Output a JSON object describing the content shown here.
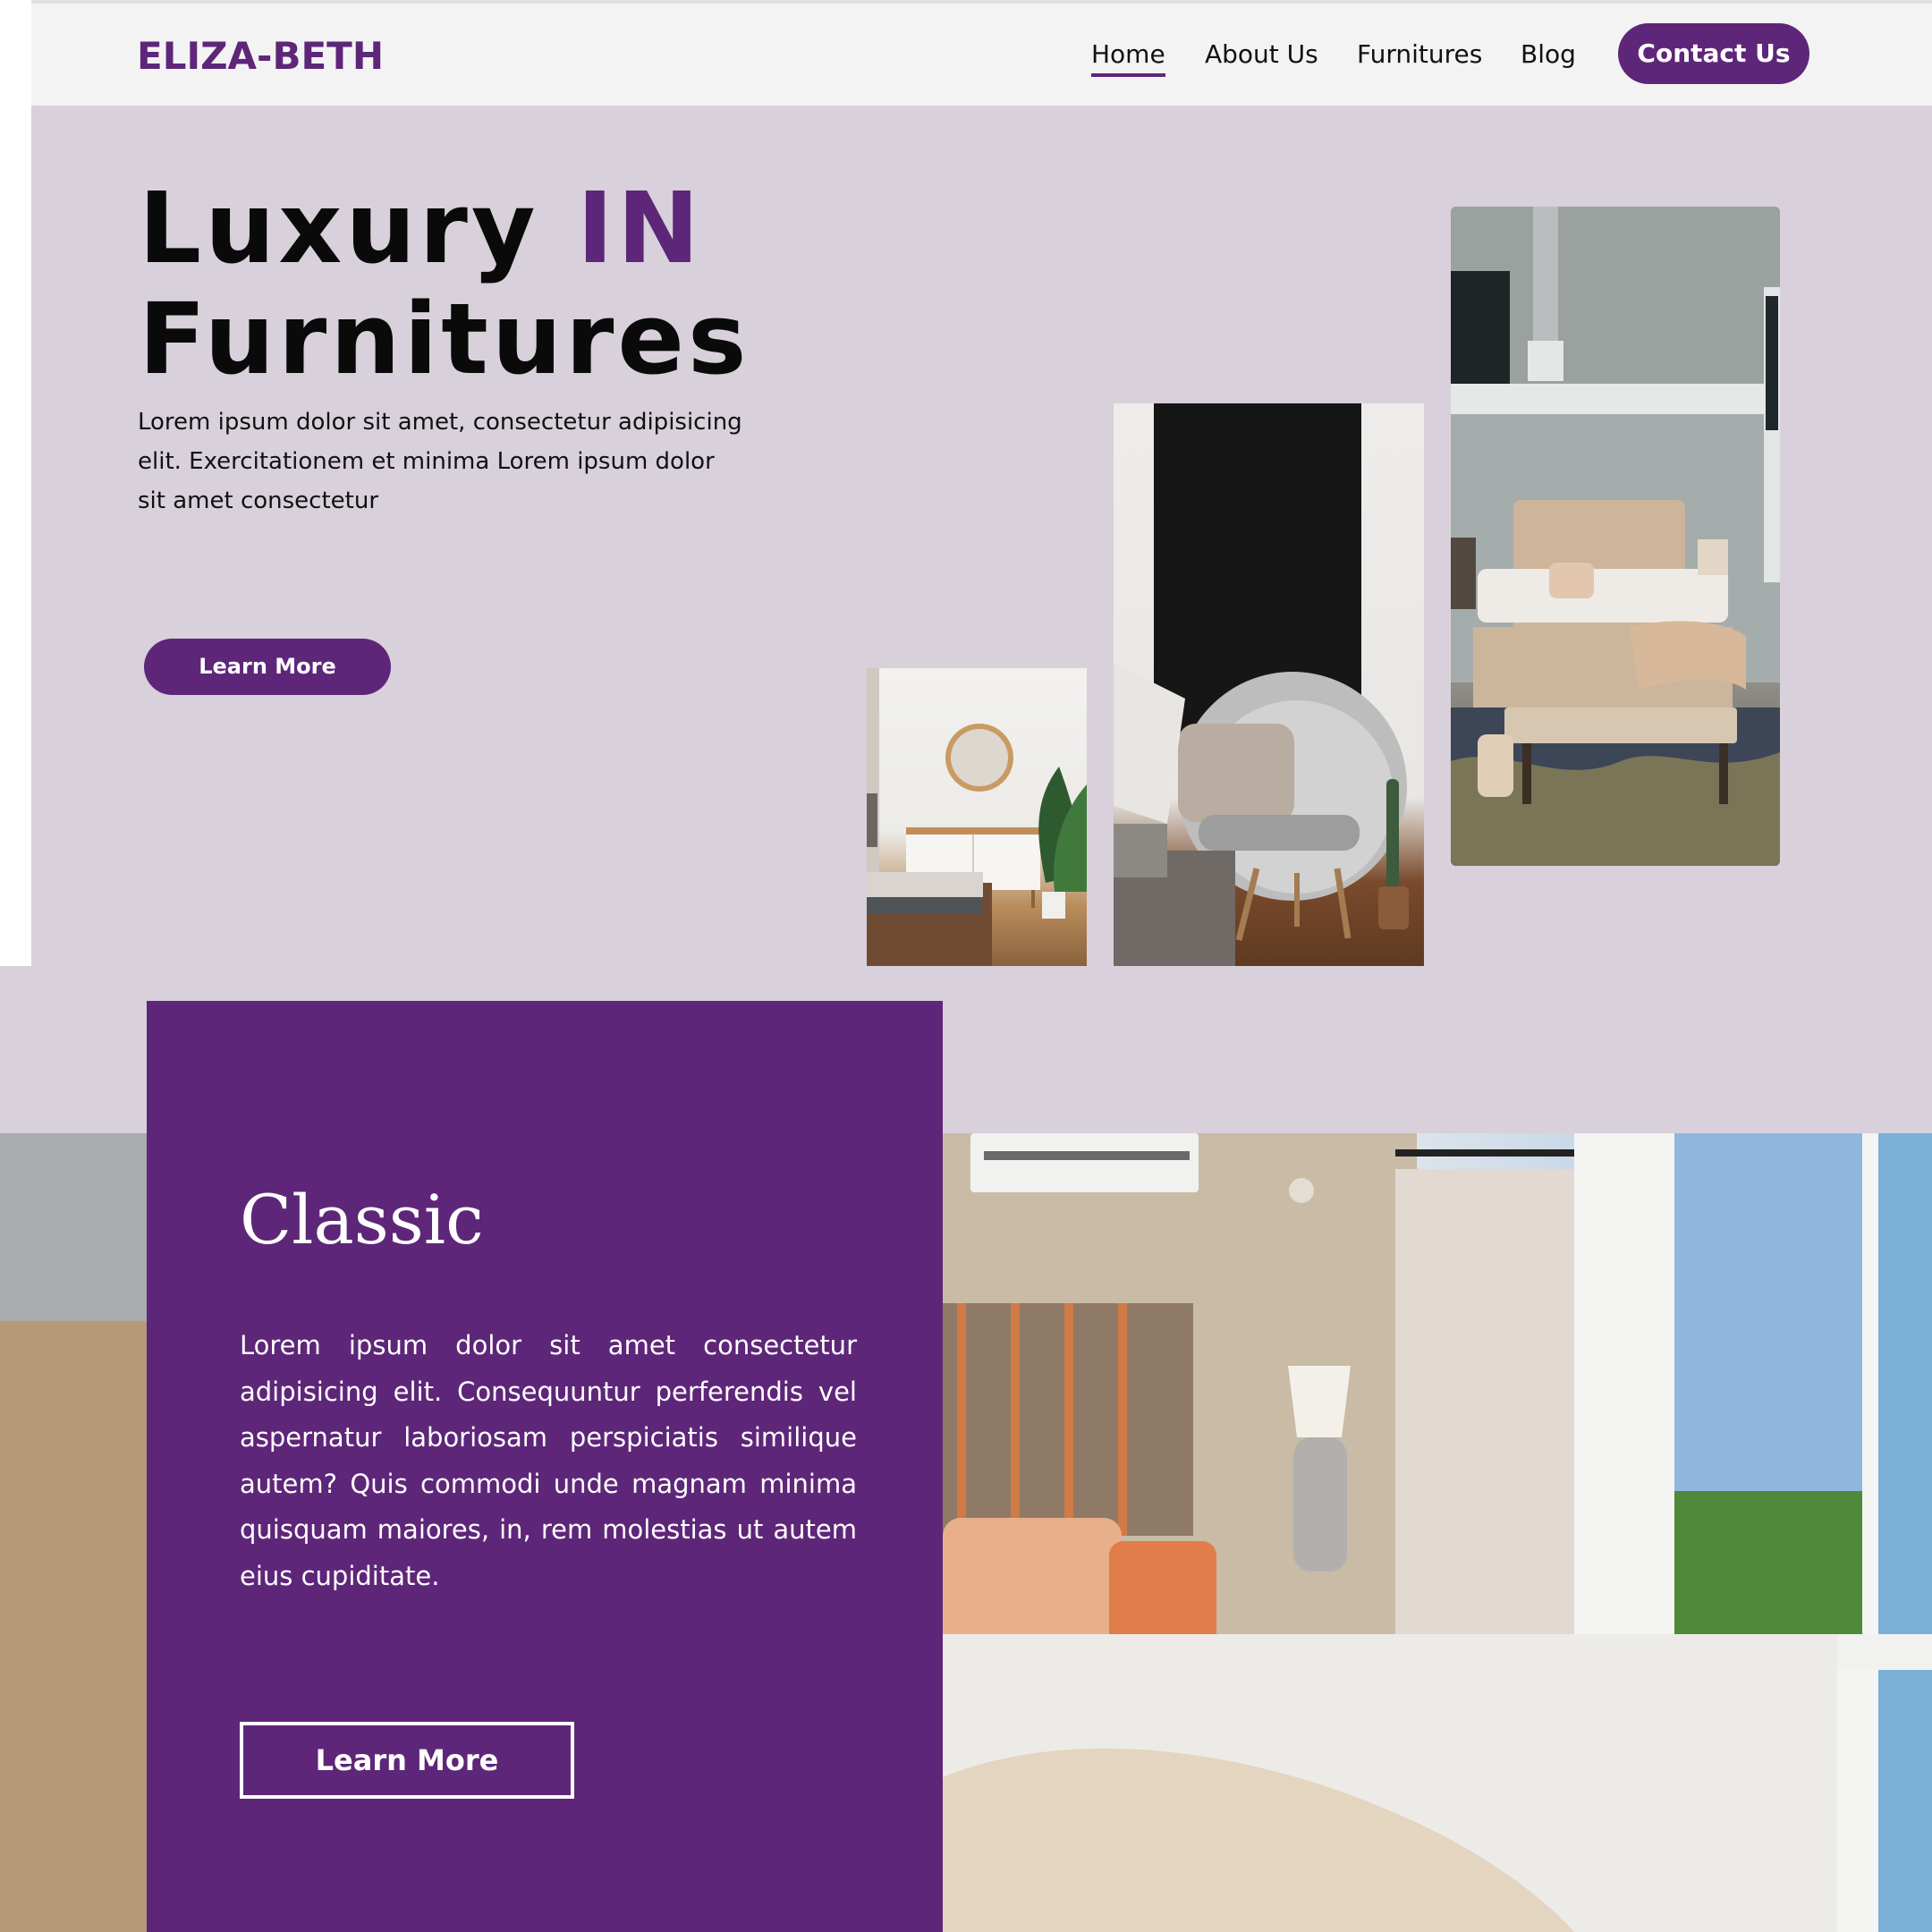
{
  "brand": {
    "logo": "ELIZA-BETH"
  },
  "nav": {
    "items": [
      {
        "label": "Home",
        "active": true
      },
      {
        "label": "About Us"
      },
      {
        "label": "Furnitures"
      },
      {
        "label": "Blog"
      }
    ],
    "contact_label": "Contact Us"
  },
  "hero": {
    "title_line1": "Luxury ",
    "title_accent": "IN",
    "title_line2": "Furnitures",
    "paragraph": "Lorem ipsum dolor sit amet, consectetur adipisicing elit. Exercitationem et minima Lorem ipsum dolor sit amet consectetur",
    "button_label": "Learn More",
    "images": [
      "dresser-room-photo",
      "accent-chair-photo",
      "bedroom-photo"
    ]
  },
  "classic": {
    "title": "Classic",
    "paragraph": "Lorem ipsum dolor sit amet consectetur adipisicing elit. Consequuntur perferendis vel aspernatur laboriosam perspiciatis similique autem? Quis commodi unde magnam minima quisquam maiores, in, rem molestias ut autem eius cupiditate.",
    "button_label": "Learn More",
    "background_image": "bedroom-with-window-photo"
  },
  "colors": {
    "brand_purple": "#5e2679",
    "hero_bg": "#d8d0da",
    "header_bg": "#f4f3f4"
  }
}
